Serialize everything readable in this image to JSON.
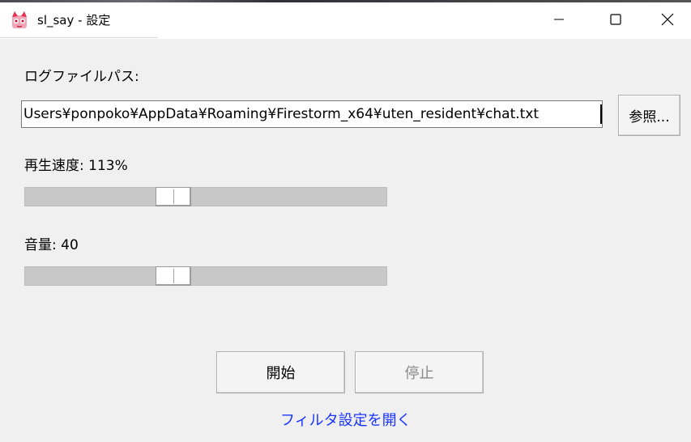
{
  "window": {
    "title": "sl_say - 設定",
    "icon": "app-icon"
  },
  "caption_buttons": {
    "minimize": "minimize-icon",
    "maximize": "maximize-icon",
    "close": "close-icon"
  },
  "log_path": {
    "label": "ログファイルパス:",
    "value": "Users¥ponpoko¥AppData¥Roaming¥Firestorm_x64¥uten_resident¥chat.txt",
    "browse_label": "参照..."
  },
  "speed": {
    "label_prefix": "再生速度: ",
    "value_text": "113%",
    "slider_value": 0.4
  },
  "volume": {
    "label_prefix": "音量: ",
    "value_text": "40",
    "slider_value": 0.4
  },
  "actions": {
    "start_label": "開始",
    "stop_label": "停止"
  },
  "filter_link": {
    "label": "フィルタ設定を開く"
  },
  "colors": {
    "link": "#1a33ff",
    "disabled_text": "#8a8a8a"
  }
}
